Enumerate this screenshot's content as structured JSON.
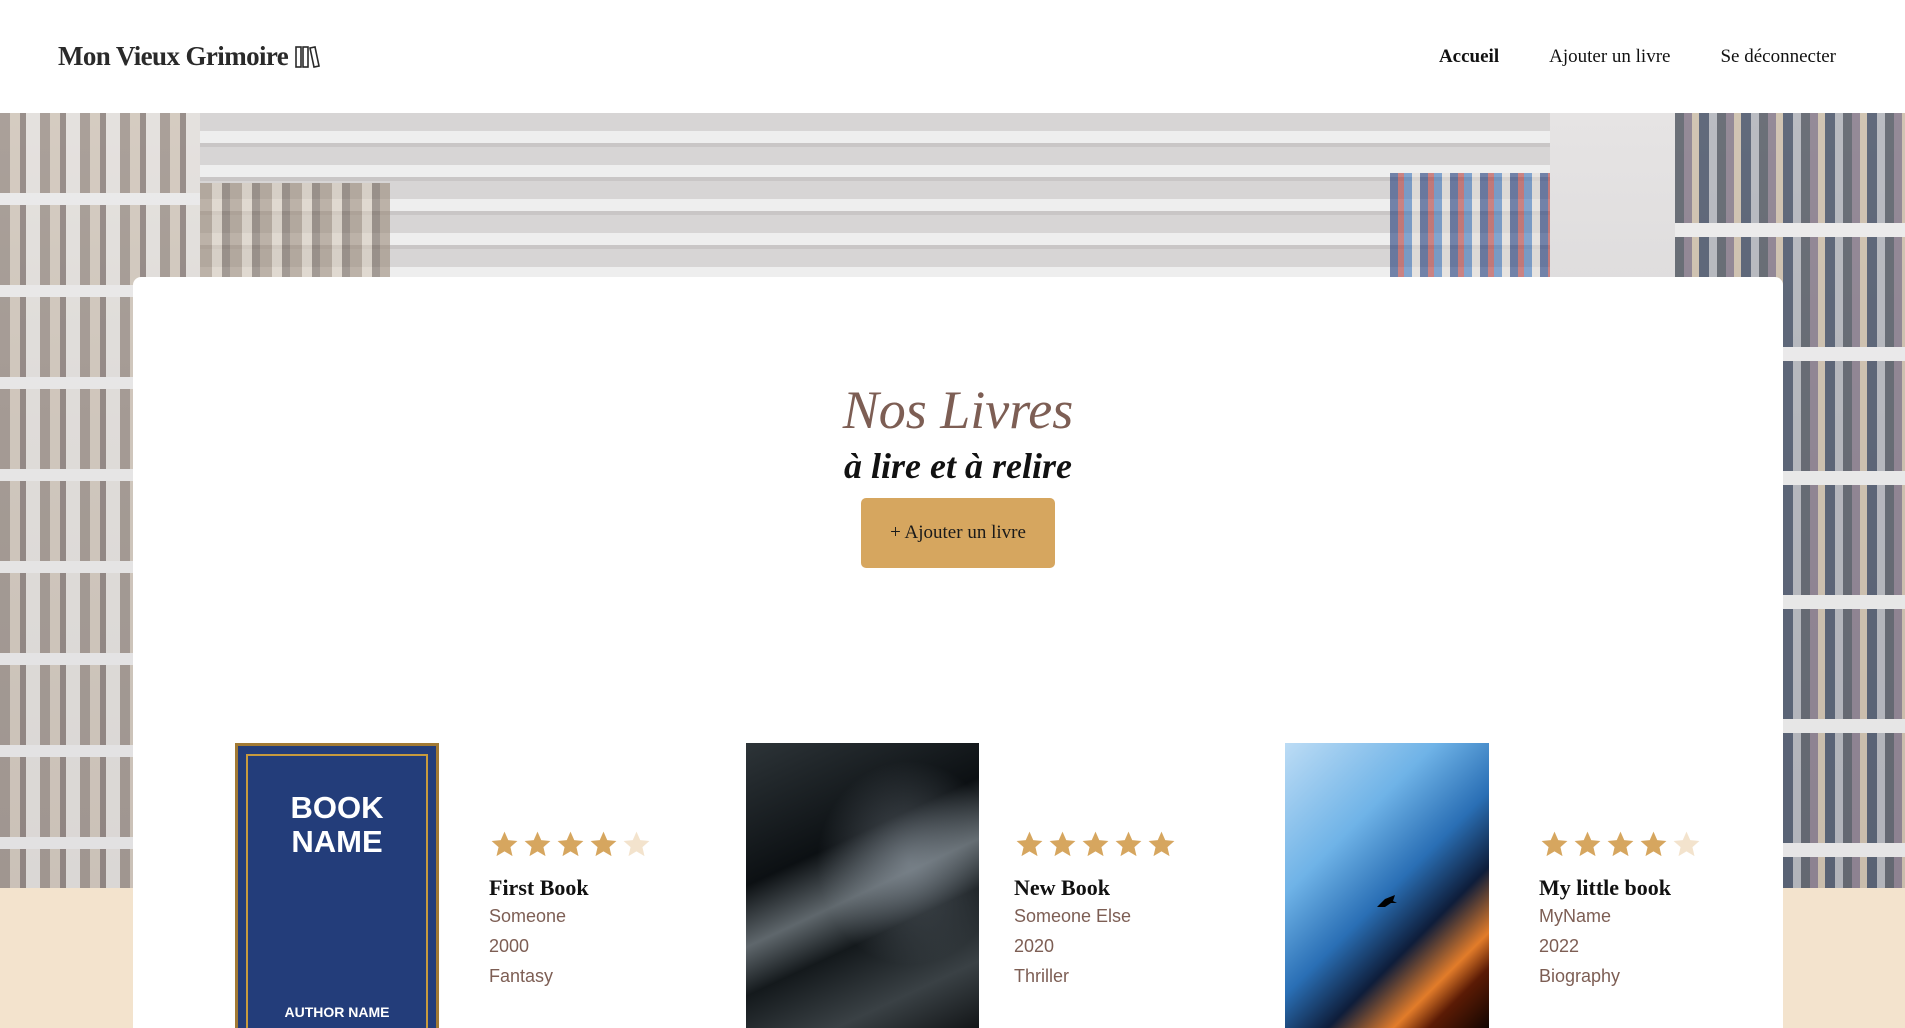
{
  "header": {
    "logo_text": "Mon Vieux Grimoire",
    "nav": [
      {
        "label": "Accueil",
        "active": true
      },
      {
        "label": "Ajouter un livre",
        "active": false
      },
      {
        "label": "Se déconnecter",
        "active": false
      }
    ]
  },
  "main": {
    "title": "Nos Livres",
    "subtitle": "à lire et à relire",
    "add_button_label": "+ Ajouter un livre"
  },
  "books": [
    {
      "title": "First Book",
      "author": "Someone",
      "year": "2000",
      "genre": "Fantasy",
      "rating": 4,
      "cover_title_line1": "BOOK",
      "cover_title_line2": "NAME",
      "cover_author": "AUTHOR NAME"
    },
    {
      "title": "New Book",
      "author": "Someone Else",
      "year": "2020",
      "genre": "Thriller",
      "rating": 5
    },
    {
      "title": "My little book",
      "author": "MyName",
      "year": "2022",
      "genre": "Biography",
      "rating": 4
    }
  ],
  "colors": {
    "accent": "#d6a65f",
    "star_filled": "#d6a65f",
    "star_empty": "#f3e3cd",
    "title_brown": "#7d5e54",
    "cream": "#f3e3cd"
  }
}
